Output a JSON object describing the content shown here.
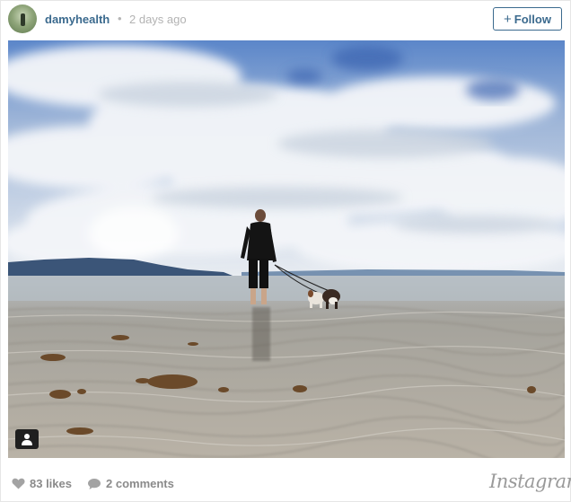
{
  "post": {
    "username": "damyhealth",
    "separator": "•",
    "timestamp": "2 days ago",
    "follow_label": "Follow",
    "likes": "83 likes",
    "comments": "2 comments",
    "brand": "Instagram"
  },
  "icons": {
    "avatar": "avatar-photo",
    "follow": "plus-icon",
    "likes": "heart-icon",
    "comments": "speech-bubble-icon",
    "user_tag": "user-tag-icon"
  },
  "colors": {
    "link": "#3b6a8e",
    "muted": "#8a8a8a",
    "sky": "#2f5fb4",
    "sand": "#a9a59e"
  }
}
